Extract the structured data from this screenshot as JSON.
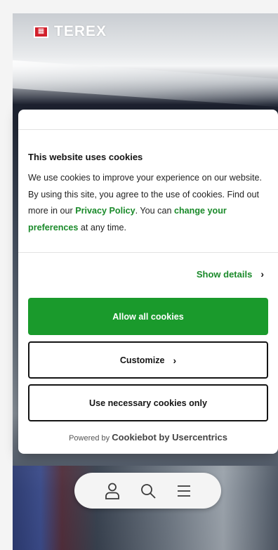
{
  "header": {
    "logo_word": "TEREX",
    "logo_mark_glyph": "▦"
  },
  "cookie_dialog": {
    "title": "This website uses cookies",
    "body_part1": "We use cookies to improve your experience on our website. By using this site, you agree to the use of cookies. Find out more in our ",
    "privacy_link": "Privacy Policy",
    "body_part2": ". You can ",
    "preferences_link": "change your preferences",
    "body_part3": " at any time.",
    "show_details_label": "Show details",
    "allow_all_label": "Allow all cookies",
    "customize_label": "Customize",
    "necessary_only_label": "Use necessary cookies only",
    "powered_by_prefix": "Powered by",
    "powered_by_brand": "Cookiebot by Usercentrics",
    "chevron_glyph": "›"
  },
  "nav": {
    "items": [
      {
        "icon": "user-icon"
      },
      {
        "icon": "search-icon"
      },
      {
        "icon": "menu-icon"
      }
    ]
  },
  "colors": {
    "accent_green": "#1a9a2c",
    "link_green": "#1a8a2a",
    "brand_red": "#d21f2b"
  }
}
